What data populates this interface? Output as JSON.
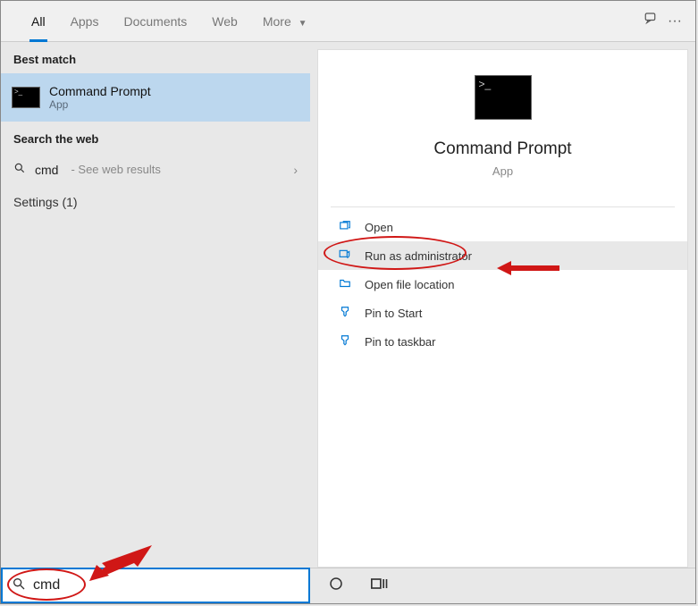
{
  "tabs": {
    "all": "All",
    "apps": "Apps",
    "documents": "Documents",
    "web": "Web",
    "more": "More"
  },
  "left": {
    "best_match_header": "Best match",
    "hit": {
      "title": "Command Prompt",
      "subtitle": "App"
    },
    "search_web_header": "Search the web",
    "web": {
      "term": "cmd",
      "hint": "- See web results"
    },
    "settings_header": "Settings",
    "settings_count": "(1)"
  },
  "detail": {
    "title": "Command Prompt",
    "subtitle": "App",
    "actions": {
      "open": "Open",
      "run_admin": "Run as administrator",
      "open_loc": "Open file location",
      "pin_start": "Pin to Start",
      "pin_taskbar": "Pin to taskbar"
    }
  },
  "search": {
    "value": "cmd"
  }
}
